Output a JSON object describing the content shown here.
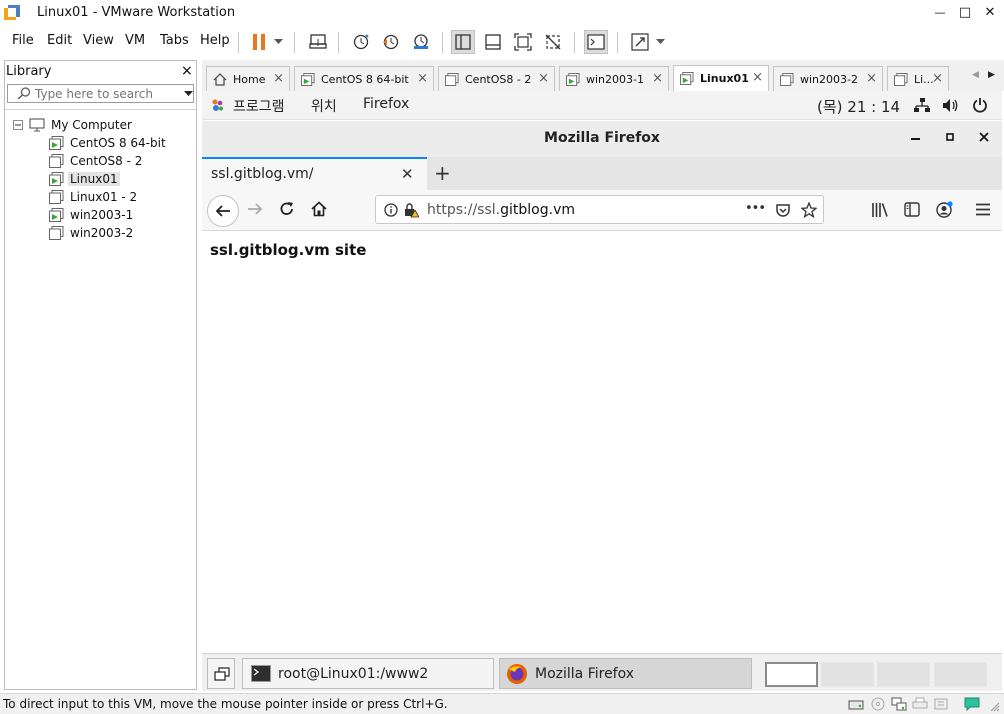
{
  "window": {
    "title": "Linux01 - VMware Workstation",
    "minimize_glyph": "—",
    "maximize_glyph": "□",
    "close_glyph": "✕"
  },
  "menu": {
    "items": [
      "File",
      "Edit",
      "View",
      "VM",
      "Tabs",
      "Help"
    ]
  },
  "toolbar": {
    "icons": [
      "pause-icon",
      "dropdown-arrow-icon",
      "send-ctrl-alt-del-icon",
      "snapshot-icon",
      "revert-snapshot-icon",
      "snapshot-manager-icon",
      "show-library-icon",
      "thumbnail-bar-icon",
      "full-screen-icon",
      "unity-icon",
      "console-view-icon",
      "stretch-guest-icon"
    ],
    "accent_pause": "#e8771d"
  },
  "library": {
    "title": "Library",
    "close_glyph": "×",
    "search_placeholder": "Type here to search",
    "tree": {
      "root_label": "My Computer",
      "expander": "⊟",
      "items": [
        {
          "label": "CentOS 8 64-bit",
          "running": true,
          "selected": false
        },
        {
          "label": "CentOS8 - 2",
          "running": false,
          "selected": false
        },
        {
          "label": "Linux01",
          "running": true,
          "selected": true
        },
        {
          "label": "Linux01 - 2",
          "running": false,
          "selected": false
        },
        {
          "label": "win2003-1",
          "running": true,
          "selected": false
        },
        {
          "label": "win2003-2",
          "running": false,
          "selected": false
        }
      ]
    }
  },
  "vm_tabs": {
    "tabs": [
      {
        "label": "Home",
        "icon": "home-icon",
        "active": false
      },
      {
        "label": "CentOS 8 64-bit",
        "icon": "vm-running-icon",
        "active": false
      },
      {
        "label": "CentOS8 - 2",
        "icon": "vm-icon",
        "active": false
      },
      {
        "label": "win2003-1",
        "icon": "vm-running-icon",
        "active": false
      },
      {
        "label": "Linux01",
        "icon": "vm-running-icon",
        "active": true
      },
      {
        "label": "win2003-2",
        "icon": "vm-icon",
        "active": false
      },
      {
        "label": "Li...",
        "icon": "vm-icon",
        "active": false
      }
    ],
    "close_glyph": "×",
    "scroll_left": "◀",
    "scroll_right": "▶"
  },
  "guest": {
    "gnome_bar": {
      "menus": [
        "프로그램",
        "위치",
        "Firefox"
      ],
      "clock": "(목) 21 : 14"
    },
    "firefox": {
      "window_title": "Mozilla Firefox",
      "tab_title": "ssl.gitblog.vm/",
      "tab_close": "✕",
      "new_tab": "+",
      "url_prefix": "https://ssl.",
      "url_host": "gitblog.vm",
      "page_actions": "•••",
      "page_heading": "ssl.gitblog.vm site"
    },
    "taskbar": {
      "items": [
        {
          "label": "root@Linux01:/www2",
          "icon": "terminal-icon",
          "active": false
        },
        {
          "label": "Mozilla Firefox",
          "icon": "firefox-icon",
          "active": true
        }
      ],
      "workspaces": 4,
      "active_workspace": 1
    }
  },
  "status_bar": {
    "text": "To direct input to this VM, move the mouse pointer inside or press Ctrl+G."
  }
}
